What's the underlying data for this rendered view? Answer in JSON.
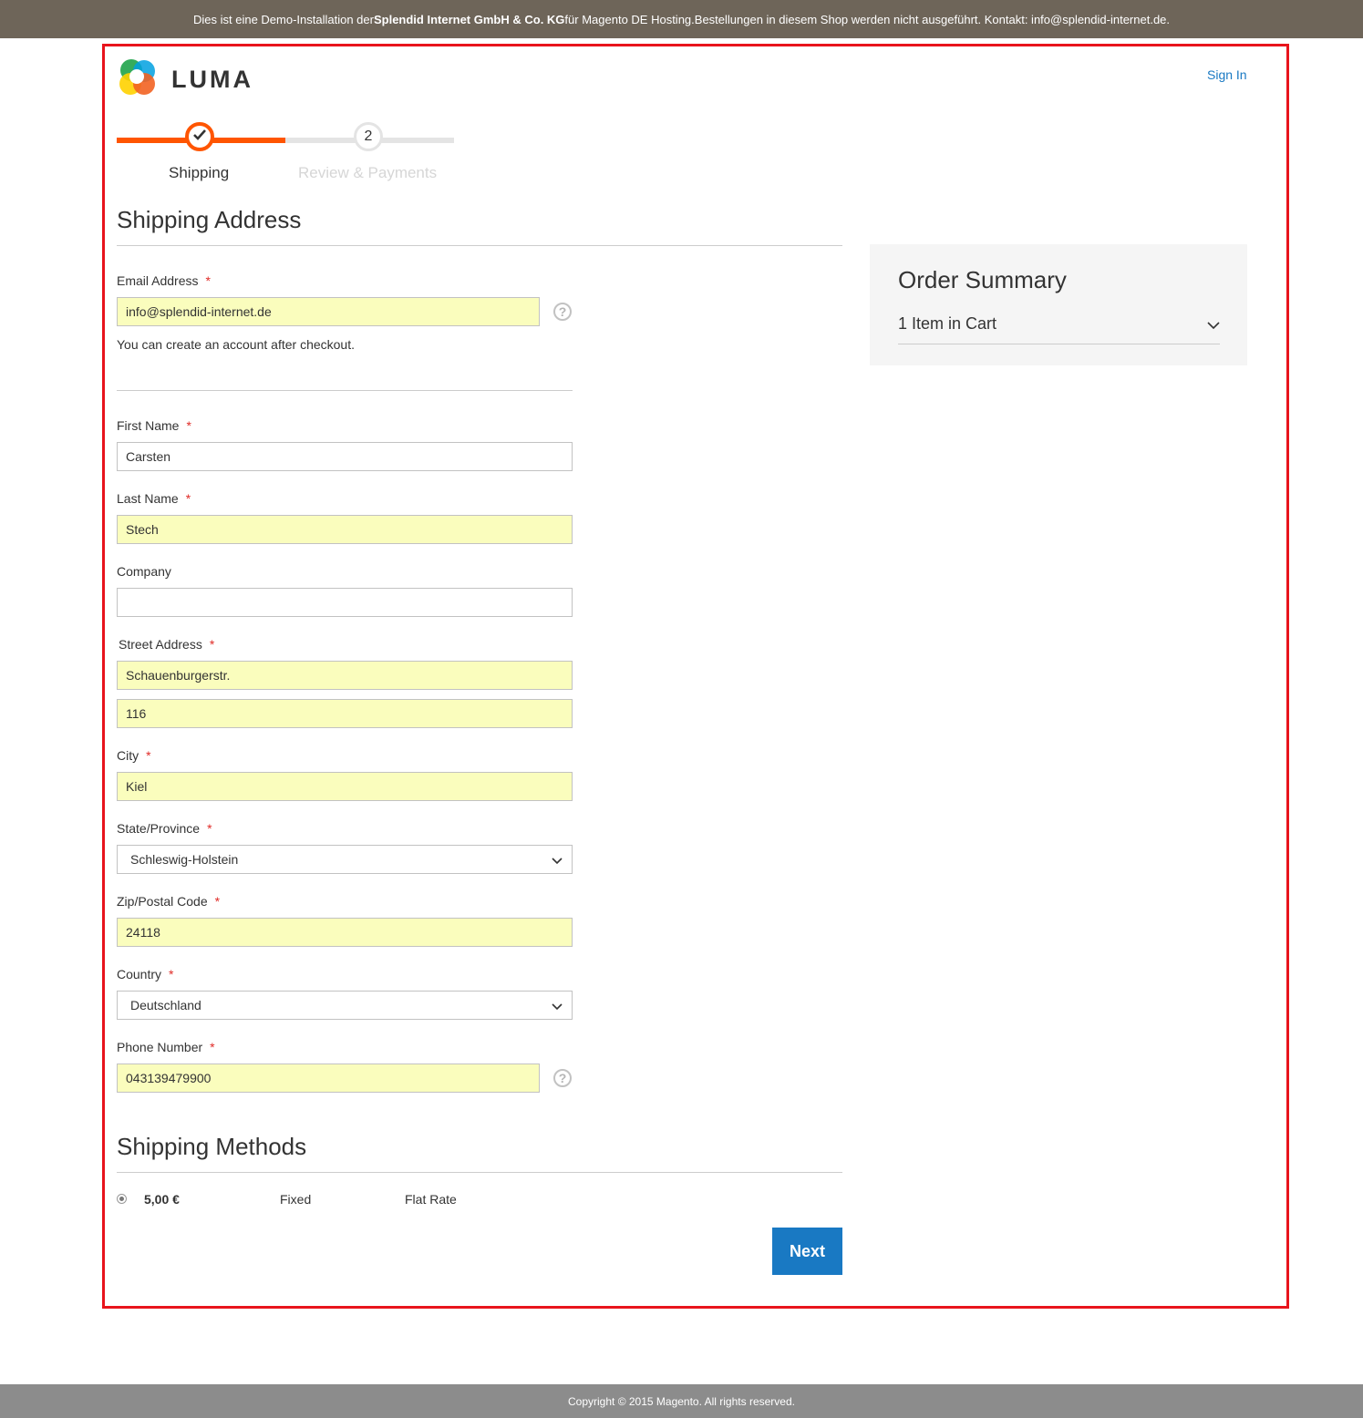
{
  "demo_bar": {
    "prefix": "Dies ist eine Demo-Installation der ",
    "company": "Splendid Internet GmbH & Co. KG",
    "suffix": " für Magento DE Hosting.Bestellungen in diesem Shop werden nicht ausgeführt. Kontakt: info@splendid-internet.de."
  },
  "header": {
    "logo_text": "LUMA",
    "sign_in": "Sign In"
  },
  "progress": {
    "steps": [
      {
        "label": "Shipping",
        "state": "complete",
        "icon": "checkmark-icon"
      },
      {
        "label": "Review & Payments",
        "number": "2",
        "state": "upcoming"
      }
    ],
    "active_color": "#ff5501"
  },
  "shipping_address": {
    "title": "Shipping Address",
    "email": {
      "label": "Email Address",
      "value": "info@splendid-internet.de",
      "note": "You can create an account after checkout."
    },
    "first_name": {
      "label": "First Name",
      "value": "Carsten"
    },
    "last_name": {
      "label": "Last Name",
      "value": "Stech"
    },
    "company": {
      "label": "Company",
      "value": ""
    },
    "street": {
      "label": "Street Address",
      "line1": "Schauenburgerstr.",
      "line2": "116"
    },
    "city": {
      "label": "City",
      "value": "Kiel"
    },
    "state": {
      "label": "State/Province",
      "value": "Schleswig-Holstein"
    },
    "zip": {
      "label": "Zip/Postal Code",
      "value": "24118"
    },
    "country": {
      "label": "Country",
      "value": "Deutschland"
    },
    "phone": {
      "label": "Phone Number",
      "value": "043139479900"
    },
    "required_mark": "*",
    "help_mark": "?"
  },
  "order_summary": {
    "title": "Order Summary",
    "items_text": "1 Item in Cart"
  },
  "shipping_methods": {
    "title": "Shipping Methods",
    "options": [
      {
        "price": "5,00 €",
        "method": "Fixed",
        "carrier": "Flat Rate",
        "selected": true
      }
    ]
  },
  "actions": {
    "next_label": "Next",
    "button_color": "#1979c3"
  },
  "footer": {
    "copyright": "Copyright © 2015 Magento. All rights reserved."
  }
}
